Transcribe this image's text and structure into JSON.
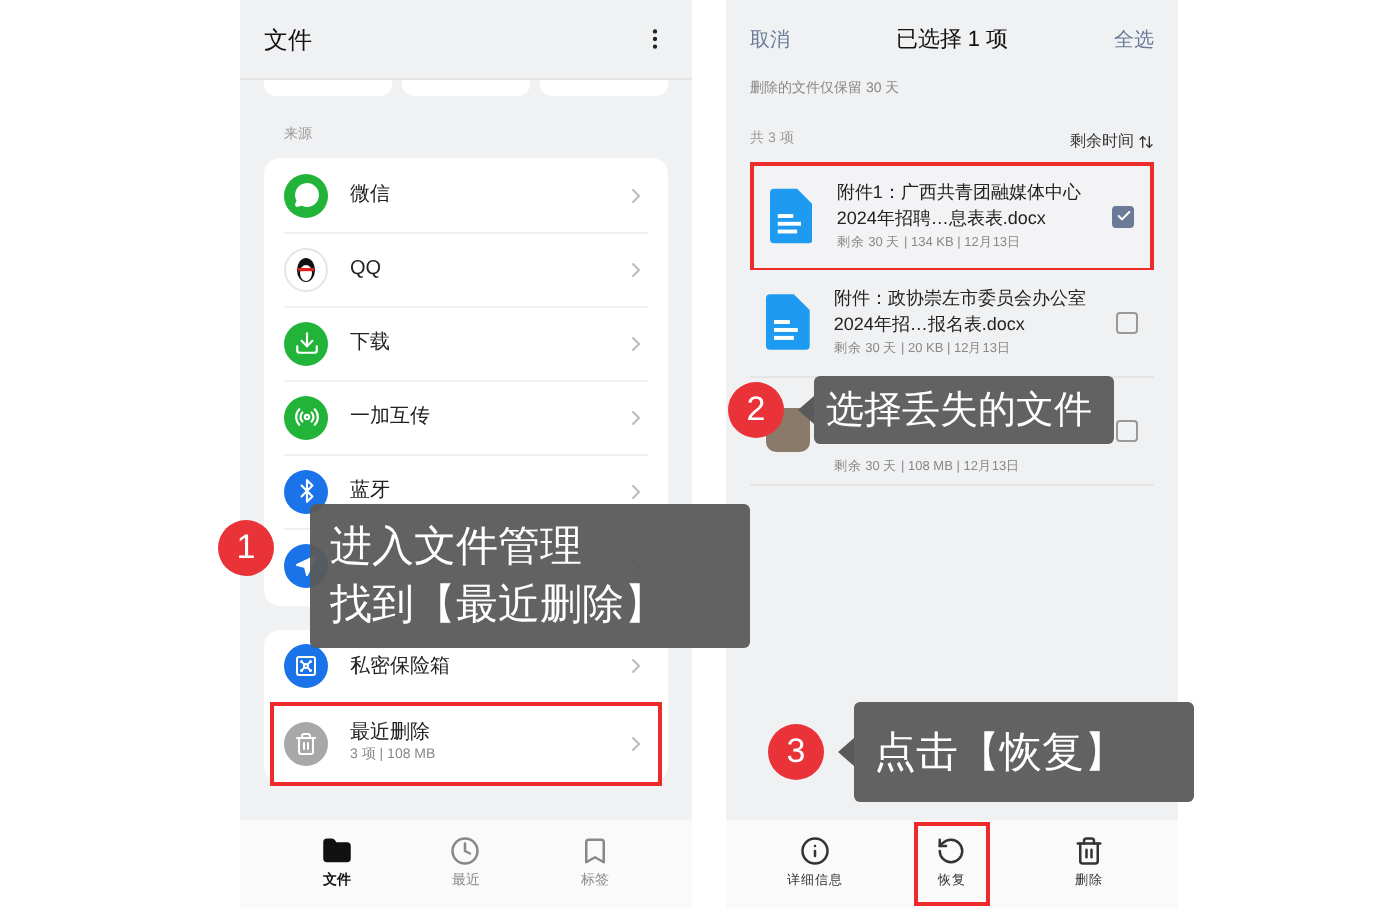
{
  "left_screen": {
    "title": "文件",
    "section_label": "来源",
    "sources": [
      {
        "label": "微信",
        "kind": "wechat"
      },
      {
        "label": "QQ",
        "kind": "qq"
      },
      {
        "label": "下载",
        "kind": "download"
      },
      {
        "label": "一加互传",
        "kind": "share"
      },
      {
        "label": "蓝牙",
        "kind": "bluetooth"
      },
      {
        "kind": "other"
      }
    ],
    "vault": {
      "label": "私密保险箱"
    },
    "recent_deleted": {
      "label": "最近删除",
      "meta": "3 项 | 108 MB",
      "highlighted": true
    },
    "nav": [
      {
        "label": "文件",
        "kind": "files",
        "selected": true
      },
      {
        "label": "最近",
        "kind": "recent",
        "selected": false
      },
      {
        "label": "标签",
        "kind": "tags",
        "selected": false
      }
    ]
  },
  "right_screen": {
    "cancel": "取消",
    "title": "已选择 1 项",
    "select_all": "全选",
    "notice": "删除的文件仅保留 30 天",
    "count": "共 3 项",
    "sort": "剩余时间",
    "files": [
      {
        "kind": "doc",
        "name": "附件1：广西共青团融媒体中心2024年招聘…息表表.docx",
        "meta": "剩余 30 天 | 134 KB | 12月13日",
        "checked": true,
        "highlighted": true
      },
      {
        "kind": "doc",
        "name": "附件：政协崇左市委员会办公室2024年招…报名表.docx",
        "meta": "剩余 30 天 | 20 KB | 12月13日",
        "checked": false,
        "highlighted": false
      },
      {
        "kind": "app",
        "meta": "剩余 30 天 | 108 MB | 12月13日",
        "checked": false,
        "highlighted": false
      }
    ],
    "actions": [
      {
        "label": "详细信息",
        "kind": "info",
        "highlighted": false
      },
      {
        "label": "恢复",
        "kind": "restore",
        "highlighted": true
      },
      {
        "label": "删除",
        "kind": "delete",
        "highlighted": false
      }
    ]
  },
  "callouts": [
    {
      "number": "1",
      "lines": [
        "进入文件管理",
        "找到【最近删除】"
      ]
    },
    {
      "number": "2",
      "lines": [
        "选择丢失的文件"
      ]
    },
    {
      "number": "3",
      "lines": [
        "点击【恢复】"
      ]
    }
  ]
}
